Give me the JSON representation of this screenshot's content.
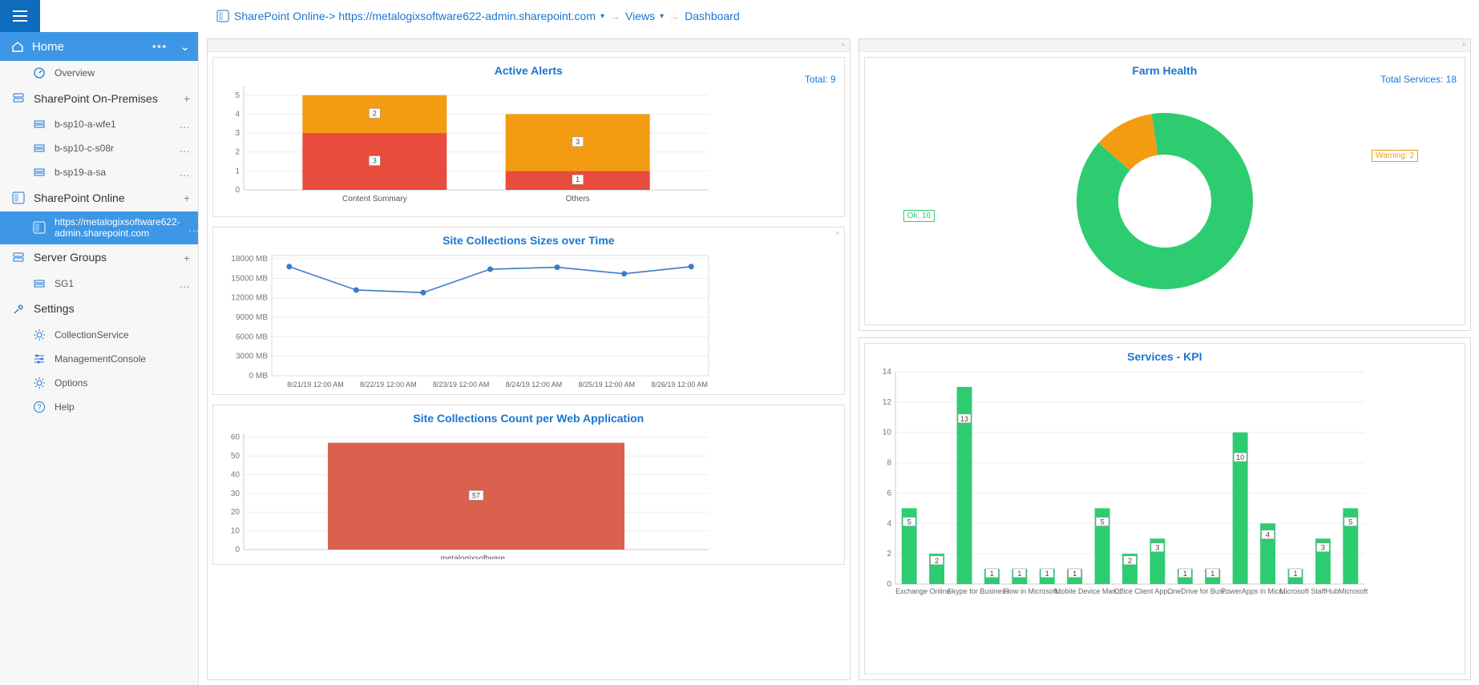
{
  "breadcrumb": {
    "root": "SharePoint Online",
    "url": "https://metalogixsoftware622-admin.sharepoint.com",
    "views": "Views",
    "dashboard": "Dashboard"
  },
  "sidebar": {
    "home": "Home",
    "items": [
      {
        "label": "Overview",
        "type": "child",
        "icon": "gauge"
      },
      {
        "label": "SharePoint On-Premises",
        "type": "header",
        "icon": "server",
        "action": "plus"
      },
      {
        "label": "b-sp10-a-wfe1",
        "type": "child",
        "icon": "server-sm",
        "action": "dots"
      },
      {
        "label": "b-sp10-c-s08r",
        "type": "child",
        "icon": "server-sm",
        "action": "dots"
      },
      {
        "label": "b-sp19-a-sa",
        "type": "child",
        "icon": "server-sm",
        "action": "dots"
      },
      {
        "label": "SharePoint Online",
        "type": "header",
        "icon": "sp",
        "action": "plus"
      },
      {
        "label": "https://metalogixsoftware622-admin.sharepoint.com",
        "type": "child",
        "icon": "sp",
        "selected": true,
        "action": "dots"
      },
      {
        "label": "Server Groups",
        "type": "header",
        "icon": "server",
        "action": "plus"
      },
      {
        "label": "SG1",
        "type": "child",
        "icon": "server-sm",
        "action": "dots"
      },
      {
        "label": "Settings",
        "type": "header",
        "icon": "wrench"
      },
      {
        "label": "CollectionService",
        "type": "child",
        "icon": "gear"
      },
      {
        "label": "ManagementConsole",
        "type": "child",
        "icon": "sliders"
      },
      {
        "label": "Options",
        "type": "child",
        "icon": "gear"
      },
      {
        "label": "Help",
        "type": "child",
        "icon": "help"
      }
    ]
  },
  "chart_data": [
    {
      "id": "active_alerts",
      "title": "Active Alerts",
      "total_label": "Total:",
      "total_value": 9,
      "type": "stacked-bar",
      "categories": [
        "Content Summary",
        "Others"
      ],
      "series": [
        {
          "name": "red",
          "color": "#e74c3c",
          "values": [
            3,
            1
          ]
        },
        {
          "name": "orange",
          "color": "#f39c12",
          "values": [
            2,
            3
          ]
        }
      ],
      "y_ticks": [
        0,
        1,
        2,
        3,
        4,
        5
      ],
      "ylim": [
        0,
        5.5
      ]
    },
    {
      "id": "site_sizes",
      "title": "Site Collections Sizes over Time",
      "type": "line",
      "y_unit": "MB",
      "x": [
        "8/21/19 12:00 AM",
        "8/22/19 12:00 AM",
        "8/23/19 12:00 AM",
        "8/24/19 12:00 AM",
        "8/25/19 12:00 AM",
        "8/26/19 12:00 AM"
      ],
      "values": [
        16800,
        13200,
        12800,
        16400,
        16700,
        15700,
        16800
      ],
      "y_ticks": [
        0,
        3000,
        6000,
        9000,
        12000,
        15000,
        18000
      ],
      "ylim": [
        0,
        18500
      ]
    },
    {
      "id": "site_count",
      "title": "Site Collections Count per Web Application",
      "type": "bar",
      "categories": [
        "metalogixsoftware..."
      ],
      "values": [
        57
      ],
      "y_ticks": [
        0,
        10,
        20,
        30,
        40,
        50,
        60
      ],
      "ylim": [
        0,
        62
      ],
      "color": "#d9614d"
    },
    {
      "id": "farm_health",
      "title": "Farm Health",
      "total_label": "Total Services:",
      "total_value": 18,
      "type": "donut",
      "segments": [
        {
          "name": "Ok",
          "value": 16,
          "color": "#2ecc71",
          "label": "Ok: 16"
        },
        {
          "name": "Warning",
          "value": 2,
          "color": "#f39c12",
          "label": "Warning: 2"
        }
      ]
    },
    {
      "id": "services_kpi",
      "title": "Services - KPI",
      "type": "bar",
      "color": "#2ecc71",
      "y_ticks": [
        0,
        2,
        4,
        6,
        8,
        10,
        12,
        14
      ],
      "ylim": [
        0,
        14
      ],
      "categories": [
        "Exchange Online",
        "",
        "Skype for Business",
        "",
        "Flow in Microsoft...",
        "",
        "Mobile Device Man...",
        "",
        "Office Client App...",
        "",
        "OneDrive for Busi...",
        "",
        "",
        "PowerApps in Micr...",
        "",
        "Microsoft StaffHub",
        "",
        "",
        "Microsoft Forms"
      ],
      "bars": [
        {
          "v": 5,
          "lbl": "5"
        },
        {
          "v": 2,
          "lbl": "2"
        },
        {
          "v": 13,
          "lbl": "13"
        },
        {
          "v": 1,
          "lbl": "1"
        },
        {
          "v": 1,
          "lbl": "1"
        },
        {
          "v": 1,
          "lbl": "1"
        },
        {
          "v": 1,
          "lbl": "1"
        },
        {
          "v": 5,
          "lbl": "5"
        },
        {
          "v": 2,
          "lbl": "2"
        },
        {
          "v": 3,
          "lbl": "3"
        },
        {
          "v": 1,
          "lbl": "1"
        },
        {
          "v": 1,
          "lbl": "1"
        },
        {
          "v": 10,
          "lbl": "10"
        },
        {
          "v": 4,
          "lbl": "4"
        },
        {
          "v": 1,
          "lbl": "1"
        },
        {
          "v": 3,
          "lbl": "3"
        },
        {
          "v": 5,
          "lbl": "5"
        }
      ],
      "x_major_labels": [
        "Exchange Online",
        "Skype for Business",
        "Flow in Microsoft...",
        "Mobile Device Man...",
        "Office Client App...",
        "OneDrive for Busi...",
        "PowerApps in Micr...",
        "Microsoft StaffHub",
        "Microsoft Forms"
      ]
    }
  ]
}
